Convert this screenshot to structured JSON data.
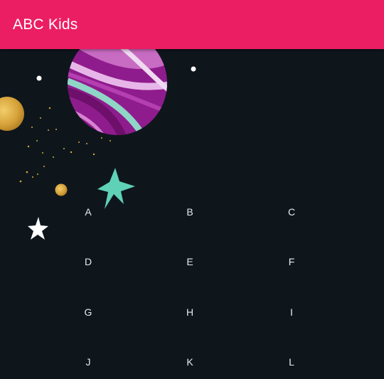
{
  "app": {
    "title": "ABC Kids"
  },
  "colors": {
    "appbar": "#ec1e63",
    "background": "#0e161c",
    "text": "#e8ecef",
    "planet_purple": "#9a1f96",
    "star_mint": "#5fd1b7",
    "gold": "#d9a93a"
  },
  "decorations": [
    "planet-image",
    "gold-planet",
    "small-gold-planet",
    "mint-star",
    "white-star",
    "gold-dust",
    "white-dot"
  ],
  "letters": [
    "A",
    "B",
    "C",
    "D",
    "E",
    "F",
    "G",
    "H",
    "I",
    "J",
    "K",
    "L"
  ]
}
